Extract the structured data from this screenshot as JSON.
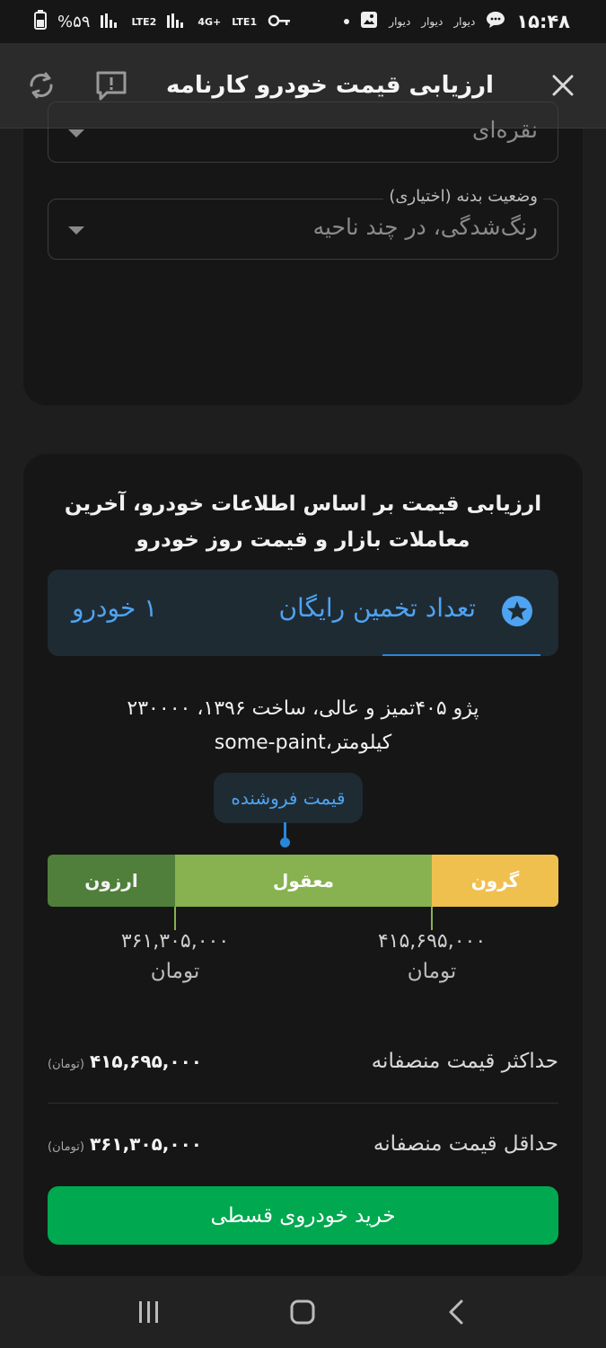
{
  "status_bar": {
    "time": "۱۵:۴۸",
    "app_labels": [
      "دیوار",
      "دیوار",
      "دیوار"
    ],
    "battery": "%۵۹",
    "network_labels": [
      "LTE2",
      "4G+",
      "LTE1"
    ]
  },
  "appbar": {
    "title": "ارزیابی قیمت خودرو کارنامه"
  },
  "form": {
    "color_field_value": "نقره‌ای",
    "body_field_label": "وضعیت بدنه (اختیاری)",
    "body_field_value": "رنگ‌شدگی، در چند ناحیه"
  },
  "evaluation": {
    "intro": "ارزیابی قیمت بر اساس اطلاعات خودرو، آخرین معاملات بازار و قیمت روز خودرو",
    "free_label": "تعداد تخمین رایگان",
    "free_count": "۱ خودرو",
    "car_desc_line1": "پژو ۴۰۵تمیز و عالی، ساخت ۱۳۹۶، ۲۳۰۰۰۰",
    "car_desc_line2": "کیلومتر،some-paint",
    "seller_price_tooltip": "قیمت فروشنده",
    "segments": {
      "cheap": "ارزون",
      "fair": "معقول",
      "expensive": "گرون"
    },
    "low_price": "۳۶۱,۳۰۵,۰۰۰",
    "high_price": "۴۱۵,۶۹۵,۰۰۰",
    "unit": "تومان",
    "max_label": "حداکثر قیمت منصفانه",
    "max_value": "۴۱۵,۶۹۵,۰۰۰",
    "min_label": "حداقل قیمت منصفانه",
    "min_value": "۳۶۱,۳۰۵,۰۰۰",
    "unit_paren": "(تومان)",
    "buy_button": "خرید خودروی قسطی"
  },
  "colors": {
    "accent_blue": "#4ea3f2",
    "button_green": "#00a84f",
    "seg_cheap": "#4f7f3a",
    "seg_fair": "#87b24f",
    "seg_expensive": "#f0c04f"
  }
}
